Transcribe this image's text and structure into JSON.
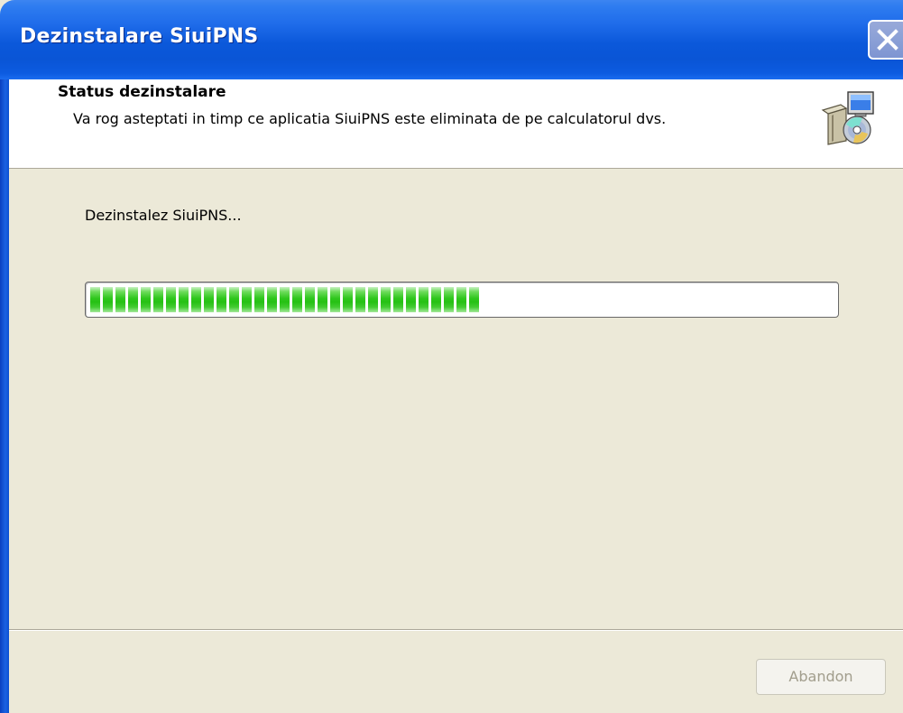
{
  "window": {
    "title": "Dezinstalare SiuiPNS"
  },
  "header": {
    "title": "Status dezinstalare",
    "description": "Va rog asteptati in timp ce aplicatia SiuiPNS este eliminata de pe calculatorul dvs.",
    "icon": "installer-package-icon"
  },
  "main": {
    "status_text": "Dezinstalez SiuiPNS...",
    "progress_fraction": 0.52,
    "progress_color": "#2fc61d"
  },
  "footer": {
    "abandon_label": "Abandon",
    "abandon_enabled": false
  },
  "colors": {
    "titlebar": "#0b58da",
    "dialog_background": "#ece9d8",
    "header_background": "#ffffff"
  }
}
